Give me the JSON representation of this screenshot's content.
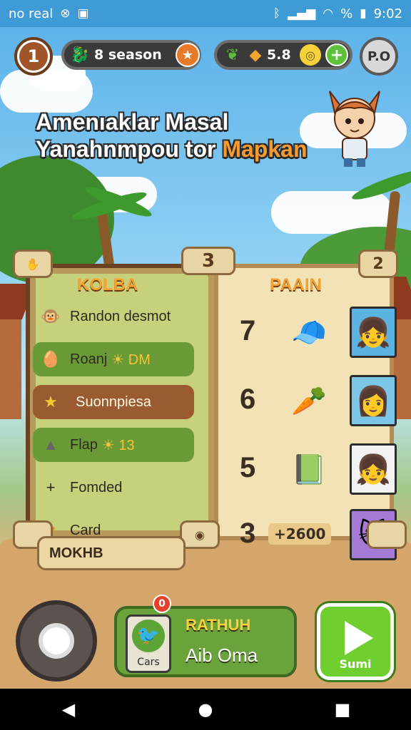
{
  "status_bar": {
    "left_text": "no real",
    "right_text": "9:02",
    "battery_text": "%"
  },
  "hud": {
    "level": "1",
    "season_label": "8 season",
    "resource_value": "5.8",
    "profile_label": "P.O"
  },
  "title": {
    "line1": "Amenıaklar Masal",
    "line2_main": "Yanahnmpou tor ",
    "line2_accent": "Mapkan"
  },
  "board": {
    "left_corner": "",
    "center_corner": "3",
    "right_corner": "2",
    "left_heading": "KOLBA",
    "right_heading": "PAAIN",
    "menu": [
      {
        "icon": "monkey-icon",
        "label": "Randon desmot",
        "tag": ""
      },
      {
        "icon": "egg-icon",
        "label": "Roanj",
        "tag": "☀ DM"
      },
      {
        "icon": "star-icon",
        "label": "Suonnpiesa",
        "tag": ""
      },
      {
        "icon": "rock-icon",
        "label": "Flap",
        "tag": "☀ 13"
      },
      {
        "icon": "plus-icon",
        "label": "Fomded",
        "tag": ""
      },
      {
        "icon": "heart-icon",
        "label": "Card",
        "tag": ""
      }
    ],
    "ranks": [
      {
        "rank": "7",
        "item": "character-hat-icon",
        "portrait": "orange-hair-girl-icon"
      },
      {
        "rank": "6",
        "item": "carrot-icon",
        "portrait": "red-hat-girl-icon"
      },
      {
        "rank": "5",
        "item": "book-icon",
        "portrait": "brown-hair-girl-icon"
      },
      {
        "rank": "3",
        "score": "+2600",
        "portrait": "cat-boy-icon"
      }
    ],
    "scroll_label": "MOKHB"
  },
  "bottom": {
    "notification_count": "0",
    "card_thumb_label": "Cars",
    "card_title": "RATHUH",
    "card_subtitle": "Aib Oma",
    "play_label": "Sumi"
  },
  "colors": {
    "accent": "#f49a30",
    "play": "#6fcf2e",
    "panel_green": "#6aa23b"
  }
}
